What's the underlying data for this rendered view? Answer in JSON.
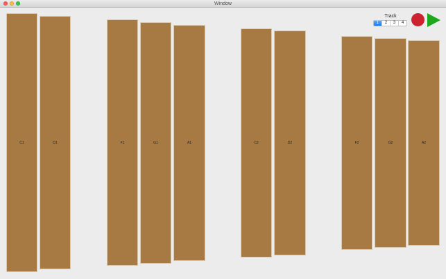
{
  "window": {
    "title": "Window"
  },
  "track": {
    "label": "Track",
    "options": [
      "1",
      "2",
      "3",
      "4"
    ],
    "selected": "1"
  },
  "controls": {
    "record_color": "#cd2331",
    "play_color": "#1ea81e"
  },
  "keys": [
    {
      "label": "C1"
    },
    {
      "label": "D1"
    },
    {
      "label": "F1"
    },
    {
      "label": "G1"
    },
    {
      "label": "A1"
    },
    {
      "label": "C2"
    },
    {
      "label": "D2"
    },
    {
      "label": "F2"
    },
    {
      "label": "G2"
    },
    {
      "label": "A2"
    }
  ],
  "colors": {
    "key": "#a87a43",
    "background": "#ececec"
  }
}
